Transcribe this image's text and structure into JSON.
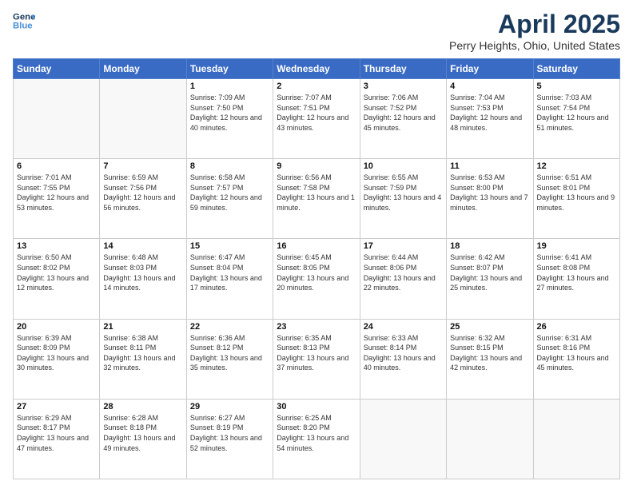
{
  "header": {
    "logo_line1": "General",
    "logo_line2": "Blue",
    "title": "April 2025",
    "subtitle": "Perry Heights, Ohio, United States"
  },
  "weekdays": [
    "Sunday",
    "Monday",
    "Tuesday",
    "Wednesday",
    "Thursday",
    "Friday",
    "Saturday"
  ],
  "weeks": [
    [
      {
        "day": "",
        "info": ""
      },
      {
        "day": "",
        "info": ""
      },
      {
        "day": "1",
        "info": "Sunrise: 7:09 AM\nSunset: 7:50 PM\nDaylight: 12 hours and 40 minutes."
      },
      {
        "day": "2",
        "info": "Sunrise: 7:07 AM\nSunset: 7:51 PM\nDaylight: 12 hours and 43 minutes."
      },
      {
        "day": "3",
        "info": "Sunrise: 7:06 AM\nSunset: 7:52 PM\nDaylight: 12 hours and 45 minutes."
      },
      {
        "day": "4",
        "info": "Sunrise: 7:04 AM\nSunset: 7:53 PM\nDaylight: 12 hours and 48 minutes."
      },
      {
        "day": "5",
        "info": "Sunrise: 7:03 AM\nSunset: 7:54 PM\nDaylight: 12 hours and 51 minutes."
      }
    ],
    [
      {
        "day": "6",
        "info": "Sunrise: 7:01 AM\nSunset: 7:55 PM\nDaylight: 12 hours and 53 minutes."
      },
      {
        "day": "7",
        "info": "Sunrise: 6:59 AM\nSunset: 7:56 PM\nDaylight: 12 hours and 56 minutes."
      },
      {
        "day": "8",
        "info": "Sunrise: 6:58 AM\nSunset: 7:57 PM\nDaylight: 12 hours and 59 minutes."
      },
      {
        "day": "9",
        "info": "Sunrise: 6:56 AM\nSunset: 7:58 PM\nDaylight: 13 hours and 1 minute."
      },
      {
        "day": "10",
        "info": "Sunrise: 6:55 AM\nSunset: 7:59 PM\nDaylight: 13 hours and 4 minutes."
      },
      {
        "day": "11",
        "info": "Sunrise: 6:53 AM\nSunset: 8:00 PM\nDaylight: 13 hours and 7 minutes."
      },
      {
        "day": "12",
        "info": "Sunrise: 6:51 AM\nSunset: 8:01 PM\nDaylight: 13 hours and 9 minutes."
      }
    ],
    [
      {
        "day": "13",
        "info": "Sunrise: 6:50 AM\nSunset: 8:02 PM\nDaylight: 13 hours and 12 minutes."
      },
      {
        "day": "14",
        "info": "Sunrise: 6:48 AM\nSunset: 8:03 PM\nDaylight: 13 hours and 14 minutes."
      },
      {
        "day": "15",
        "info": "Sunrise: 6:47 AM\nSunset: 8:04 PM\nDaylight: 13 hours and 17 minutes."
      },
      {
        "day": "16",
        "info": "Sunrise: 6:45 AM\nSunset: 8:05 PM\nDaylight: 13 hours and 20 minutes."
      },
      {
        "day": "17",
        "info": "Sunrise: 6:44 AM\nSunset: 8:06 PM\nDaylight: 13 hours and 22 minutes."
      },
      {
        "day": "18",
        "info": "Sunrise: 6:42 AM\nSunset: 8:07 PM\nDaylight: 13 hours and 25 minutes."
      },
      {
        "day": "19",
        "info": "Sunrise: 6:41 AM\nSunset: 8:08 PM\nDaylight: 13 hours and 27 minutes."
      }
    ],
    [
      {
        "day": "20",
        "info": "Sunrise: 6:39 AM\nSunset: 8:09 PM\nDaylight: 13 hours and 30 minutes."
      },
      {
        "day": "21",
        "info": "Sunrise: 6:38 AM\nSunset: 8:11 PM\nDaylight: 13 hours and 32 minutes."
      },
      {
        "day": "22",
        "info": "Sunrise: 6:36 AM\nSunset: 8:12 PM\nDaylight: 13 hours and 35 minutes."
      },
      {
        "day": "23",
        "info": "Sunrise: 6:35 AM\nSunset: 8:13 PM\nDaylight: 13 hours and 37 minutes."
      },
      {
        "day": "24",
        "info": "Sunrise: 6:33 AM\nSunset: 8:14 PM\nDaylight: 13 hours and 40 minutes."
      },
      {
        "day": "25",
        "info": "Sunrise: 6:32 AM\nSunset: 8:15 PM\nDaylight: 13 hours and 42 minutes."
      },
      {
        "day": "26",
        "info": "Sunrise: 6:31 AM\nSunset: 8:16 PM\nDaylight: 13 hours and 45 minutes."
      }
    ],
    [
      {
        "day": "27",
        "info": "Sunrise: 6:29 AM\nSunset: 8:17 PM\nDaylight: 13 hours and 47 minutes."
      },
      {
        "day": "28",
        "info": "Sunrise: 6:28 AM\nSunset: 8:18 PM\nDaylight: 13 hours and 49 minutes."
      },
      {
        "day": "29",
        "info": "Sunrise: 6:27 AM\nSunset: 8:19 PM\nDaylight: 13 hours and 52 minutes."
      },
      {
        "day": "30",
        "info": "Sunrise: 6:25 AM\nSunset: 8:20 PM\nDaylight: 13 hours and 54 minutes."
      },
      {
        "day": "",
        "info": ""
      },
      {
        "day": "",
        "info": ""
      },
      {
        "day": "",
        "info": ""
      }
    ]
  ]
}
